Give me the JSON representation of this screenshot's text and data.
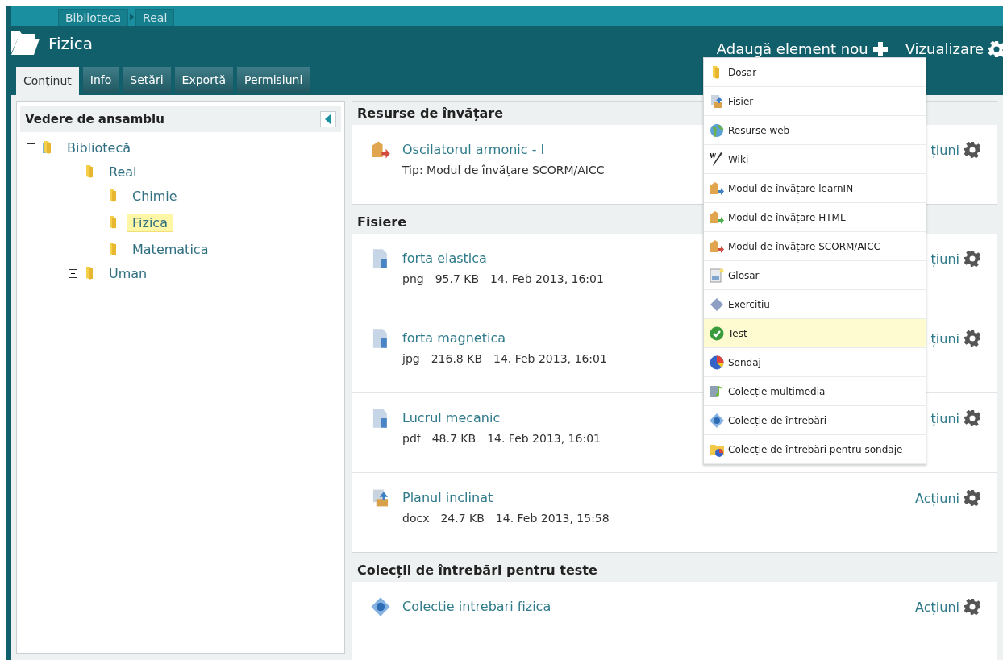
{
  "breadcrumbs": [
    "Biblioteca",
    "Real"
  ],
  "title": "Fizica",
  "header_actions": [
    {
      "label": "Adaugă element nou",
      "kind": "add"
    },
    {
      "label": "Vizualizare",
      "kind": "view"
    }
  ],
  "tabs": [
    {
      "label": "Conținut",
      "selected": true
    },
    {
      "label": "Info",
      "selected": false
    },
    {
      "label": "Setări",
      "selected": false
    },
    {
      "label": "Exportă",
      "selected": false
    },
    {
      "label": "Permisiuni",
      "selected": false
    }
  ],
  "sidebar": {
    "title": "Vedere de ansamblu",
    "tree": [
      {
        "label": "Bibliotecă",
        "kind": "library",
        "expanded": true,
        "selected": false,
        "children": [
          {
            "label": "Real",
            "kind": "folder",
            "expanded": true,
            "selected": false,
            "children": [
              {
                "label": "Chimie",
                "kind": "folder",
                "selected": false
              },
              {
                "label": "Fizica",
                "kind": "folder",
                "selected": true
              },
              {
                "label": "Matematica",
                "kind": "folder",
                "selected": false
              }
            ]
          },
          {
            "label": "Uman",
            "kind": "folder",
            "expanded": false,
            "selected": false
          }
        ]
      }
    ]
  },
  "sections": [
    {
      "title": "Resurse de învățare",
      "items": [
        {
          "kind": "module",
          "title": "Oscilatorul armonic - I",
          "subtitle": "Tip: Modul de învățare SCORM/AICC",
          "action": "țiuni"
        }
      ]
    },
    {
      "title": "Fisiere",
      "items": [
        {
          "kind": "file",
          "title": "forta elastica",
          "meta": [
            "png",
            "95.7 KB",
            "14. Feb 2013, 16:01"
          ],
          "action": "țiuni"
        },
        {
          "kind": "file",
          "title": "forta magnetica",
          "meta": [
            "jpg",
            "216.8 KB",
            "14. Feb 2013, 16:01"
          ],
          "action": "țiuni"
        },
        {
          "kind": "file",
          "title": "Lucrul mecanic",
          "meta": [
            "pdf",
            "48.7 KB",
            "14. Feb 2013, 16:01"
          ],
          "action": "țiuni"
        },
        {
          "kind": "upload",
          "title": "Planul inclinat",
          "meta": [
            "docx",
            "24.7 KB",
            "14. Feb 2013, 15:58"
          ],
          "action": "Acțiuni"
        }
      ]
    },
    {
      "title": "Colecții de întrebări pentru teste",
      "items": [
        {
          "kind": "question",
          "title": "Colectie intrebari fizica",
          "action": "Acțiuni"
        }
      ]
    }
  ],
  "add_menu": [
    {
      "label": "Dosar",
      "kind": "folder",
      "highlighted": false
    },
    {
      "label": "Fisier",
      "kind": "upload",
      "highlighted": false
    },
    {
      "label": "Resurse web",
      "kind": "globe",
      "highlighted": false
    },
    {
      "label": "Wiki",
      "kind": "wiki",
      "highlighted": false
    },
    {
      "label": "Modul de învățare learnIN",
      "kind": "module-blue",
      "highlighted": false
    },
    {
      "label": "Modul de învățare HTML",
      "kind": "module-green",
      "highlighted": false
    },
    {
      "label": "Modul de învățare SCORM/AICC",
      "kind": "module-red",
      "highlighted": false
    },
    {
      "label": "Glosar",
      "kind": "glossary",
      "highlighted": false
    },
    {
      "label": "Exercitiu",
      "kind": "exercise",
      "highlighted": false
    },
    {
      "label": "Test",
      "kind": "test",
      "highlighted": true
    },
    {
      "label": "Sondaj",
      "kind": "poll",
      "highlighted": false
    },
    {
      "label": "Colecție multimedia",
      "kind": "media",
      "highlighted": false
    },
    {
      "label": "Colecție de întrebări",
      "kind": "question",
      "highlighted": false
    },
    {
      "label": "Colecție de întrebări pentru sondaje",
      "kind": "poll-collection",
      "highlighted": false
    }
  ]
}
